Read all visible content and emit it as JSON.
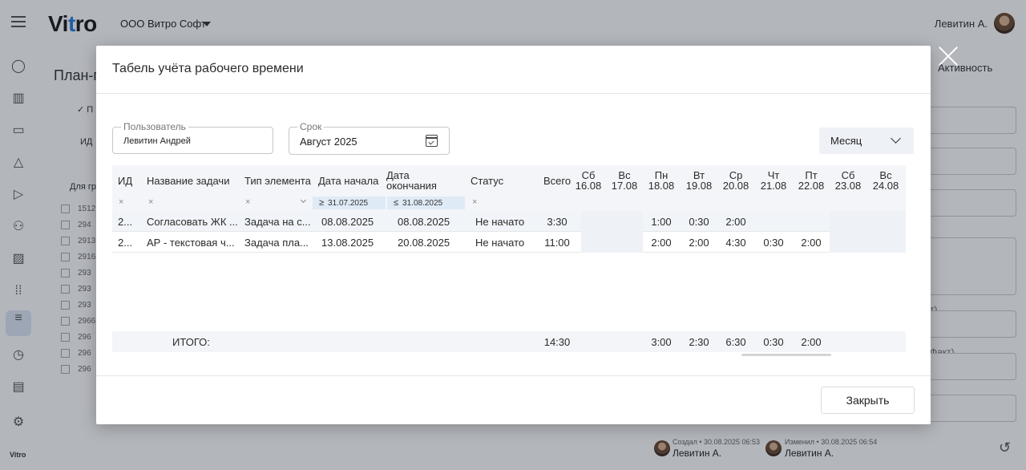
{
  "app": {
    "logo_main": "Vi",
    "logo_accent": "t",
    "logo_tail": "ro",
    "org_name": "ООО Витро Софт",
    "user_name": "Левитин А.",
    "sidebar_logo": "Vitro"
  },
  "background": {
    "page_title": "План-г",
    "filter_chip": "✓ П",
    "col_id": "ИД",
    "group_label": "Для гр",
    "row_ids": [
      "1512",
      "294",
      "2913",
      "2916",
      "293",
      "293",
      "293",
      "2966",
      "296",
      "296",
      "296"
    ],
    "activity_tab": "Активность",
    "label_fact1": "т)",
    "label_fact2": "Факт)",
    "created_label": "Создал • 30.08.2025 06:53",
    "created_by": "Левитин А.",
    "changed_label": "Изменил • 30.08.2025 06:54",
    "changed_by": "Левитин А."
  },
  "modal": {
    "title": "Табель учёта рабочего времени",
    "user_field": {
      "label": "Пользователь",
      "value": "Левитин Андрей"
    },
    "period_field": {
      "label": "Срок",
      "value": "Август 2025"
    },
    "period_mode": "Месяц",
    "close_button": "Закрыть"
  },
  "table": {
    "headers": {
      "id": "ИД",
      "task": "Название задачи",
      "type": "Тип элемента",
      "start": "Дата начала",
      "end_line1": "Дата",
      "end_line2": "окончания",
      "status": "Статус",
      "total": "Всего"
    },
    "days": [
      {
        "dow": "Сб",
        "date": "16.08"
      },
      {
        "dow": "Вс",
        "date": "17.08"
      },
      {
        "dow": "Пн",
        "date": "18.08"
      },
      {
        "dow": "Вт",
        "date": "19.08"
      },
      {
        "dow": "Ср",
        "date": "20.08"
      },
      {
        "dow": "Чт",
        "date": "21.08"
      },
      {
        "dow": "Пт",
        "date": "22.08"
      },
      {
        "dow": "Сб",
        "date": "23.08"
      },
      {
        "dow": "Вс",
        "date": "24.08"
      }
    ],
    "filters": {
      "clear": "×",
      "start_op": "≥",
      "start_value": "31.07.2025",
      "end_op": "≤",
      "end_value": "31.08.2025"
    },
    "rows": [
      {
        "id": "2...",
        "task": "Согласовать ЖК ...",
        "type": "Задача на с...",
        "start": "08.08.2025",
        "end": "08.08.2025",
        "status": "Не начато",
        "total": "3:30",
        "days": [
          "",
          "",
          "1:00",
          "0:30",
          "2:00",
          "",
          "",
          "",
          ""
        ]
      },
      {
        "id": "2...",
        "task": "АР - текстовая ч...",
        "type": "Задача пла...",
        "start": "13.08.2025",
        "end": "20.08.2025",
        "status": "Не начато",
        "total": "11:00",
        "days": [
          "",
          "",
          "2:00",
          "2:00",
          "4:30",
          "0:30",
          "2:00",
          "",
          ""
        ]
      }
    ],
    "totals": {
      "label": "ИТОГО:",
      "total": "14:30",
      "days": [
        "",
        "",
        "3:00",
        "2:30",
        "6:30",
        "0:30",
        "2:00",
        "",
        ""
      ]
    }
  }
}
